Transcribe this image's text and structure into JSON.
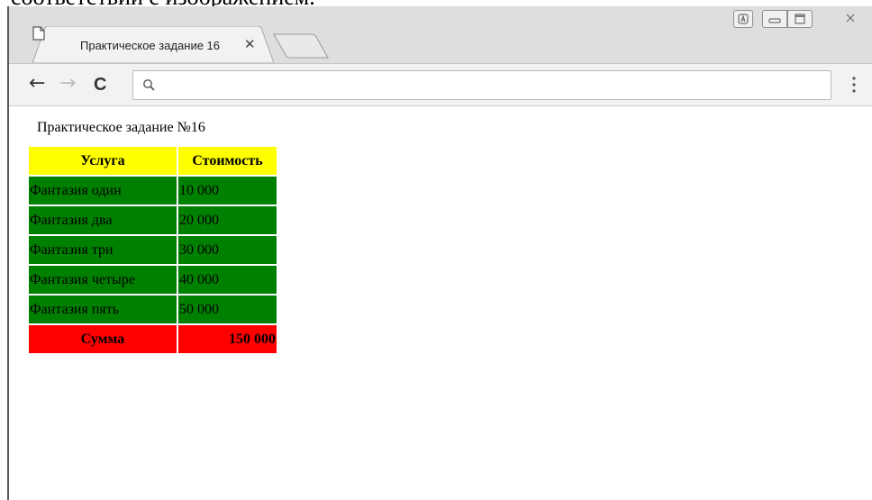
{
  "document_fragment": "соответствии с изображением.",
  "browser": {
    "tab": {
      "title": "Практическое задание 16",
      "close_glyph": "✕",
      "icon": "page-icon"
    },
    "new_tab_icon": "new-tab-icon",
    "window_buttons": [
      "account-icon",
      "minimize-icon",
      "maximize-icon",
      "close-icon"
    ],
    "nav": {
      "back_glyph": "←",
      "forward_glyph": "→",
      "reload_glyph": "C",
      "search_icon": "search-icon",
      "address_value": "",
      "menu_icon": "menu-dots-icon"
    }
  },
  "page": {
    "heading": "Практическое задание №16",
    "table": {
      "headers": [
        "Услуга",
        "Стоимость"
      ],
      "rows": [
        [
          "Фантазия один",
          "10 000"
        ],
        [
          "Фантазия два",
          "20 000"
        ],
        [
          "Фантазия три",
          "30 000"
        ],
        [
          "Фантазия четыре",
          "40 000"
        ],
        [
          "Фантазия пять",
          "50 000"
        ]
      ],
      "total": [
        "Сумма",
        "150 000"
      ]
    },
    "colors": {
      "header_bg": "#ffff00",
      "row_bg": "#008000",
      "total_bg": "#ff0000"
    }
  }
}
